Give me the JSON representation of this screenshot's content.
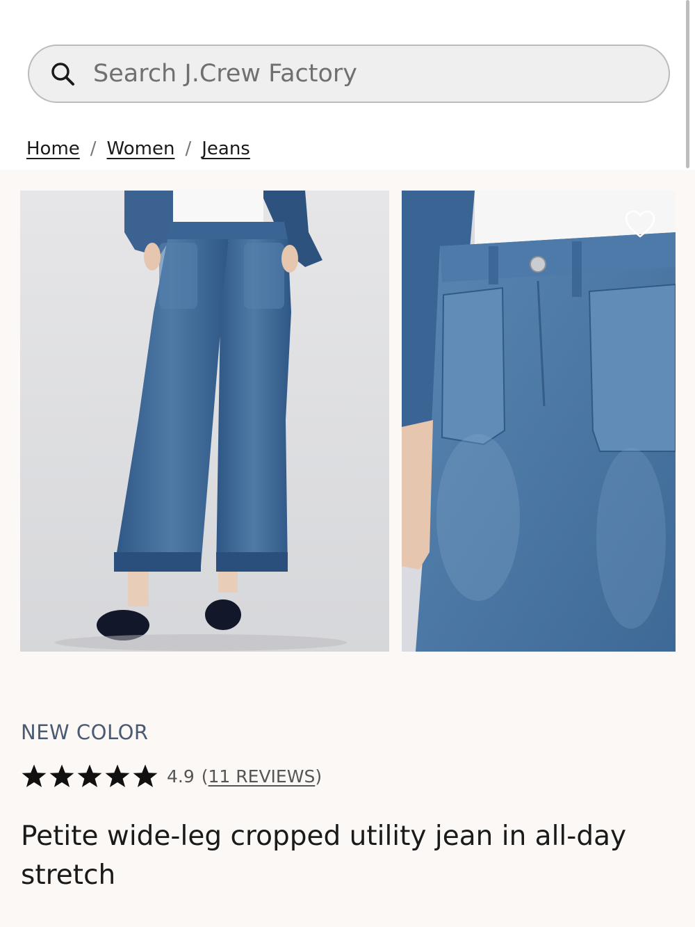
{
  "search": {
    "placeholder": "Search J.Crew Factory",
    "icon": "search-icon"
  },
  "breadcrumb": {
    "items": [
      "Home",
      "Women",
      "Jeans"
    ],
    "separator": "/"
  },
  "gallery": {
    "images": [
      {
        "alt": "model wearing wide-leg cropped jeans with navy flats"
      },
      {
        "alt": "close-up of jean waistband and front pocket"
      }
    ],
    "favorite_icon": "heart-icon"
  },
  "product": {
    "badge": "NEW COLOR",
    "rating": {
      "value": "4.9",
      "stars": 5,
      "reviews_open": "(",
      "reviews_label": "11 REVIEWS",
      "reviews_close": ")"
    },
    "title": "Petite wide-leg cropped utility jean in all-day stretch"
  },
  "colors": {
    "badge": "#4a5a73",
    "background": "#fbf8f5",
    "denim": "#3f6a98"
  }
}
